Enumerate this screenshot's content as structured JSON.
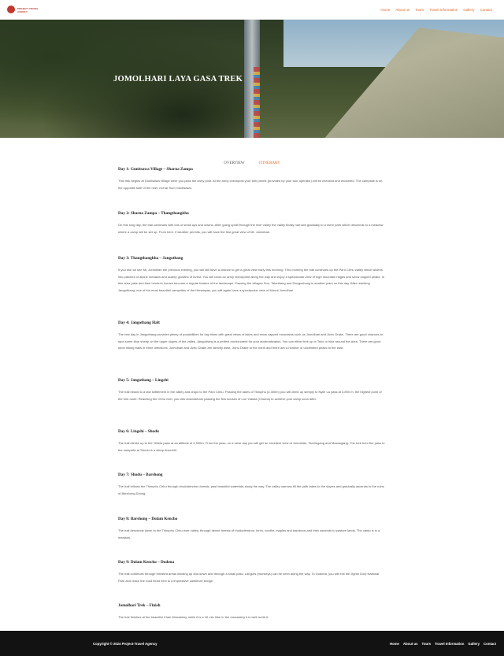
{
  "brand": {
    "logo_text": "PROJECT TRAVEL AGENCY"
  },
  "nav": [
    "Home",
    "About us",
    "Tours",
    "Travel Information",
    "Gallery",
    "Contact"
  ],
  "hero": {
    "title": "JOMOLHARI LAYA GASA TREK"
  },
  "tabs": [
    {
      "label": "OVERVIEW",
      "active": false
    },
    {
      "label": "ITINERARY",
      "active": true
    }
  ],
  "itinerary": [
    {
      "title": "Day 1: Gunitsawa Village – Sharna Zampa",
      "text": "This trek begins at Gunitsawa Village were you pass the army post. At the army checkpost your trek permit (provided by your tour operator) will be checked and endorsed. The campsite is on the opposite side of the river, not far from Gunitsawa."
    },
    {
      "title": "Day 2: Sharna Zampa – Thangthangkha",
      "text": "On this long day, the trail continues with lots of small ups and downs. After going uphill through the river valley the valley finally narrows gradually to a mere path which descends to a meadow where a camp will be set up. From here, if weather permits, you will have the first great view of Mt. Jomolhari."
    },
    {
      "title": "Day 3: Thangthangkha – Jangothang",
      "text": "If you did not see Mt. Jomolhari the previous evening, you will still have a chance to get a great view early this morning. This morning the trail continues up the Paro Chhu valley which widens into patches of alpine meadow and scanty growths of forest. You will cross an army checkpoint along the way and enjoy a spectacular view of high mountain ridges and snow capped peaks. In this area yaks and their herder's homes become a regular feature of the landscape. Passing the villages Soe, Takethang and Dangochang is another point on this day. After reaching Jangothang, one of the most beautiful campsites of the Himalayas, you will again have a spectacular view of Mount Jomolhari."
    },
    {
      "title": "Day 4: Jangothang Halt",
      "text": "The rest day in Jangothang provides plenty of possibilities for day hikes with great views of lakes and snow capped mountains such as Jomolhari and Jichu Drake. There are good chances to spot some blue sheep on the upper slopes of the valley. Jangothang is a perfect environment for your acclimatization. You can either trek up to Tsho or hike around the area. There are good short hiking trails in three directions. Jomolhari and Jichu Drake are directly west, Jichu Drake to the north and there are a number of unclimbed peaks to the east."
    },
    {
      "title": "Day 5: Jangothang – Lingshi",
      "text": "The trail heads to a last settlement in the valley and drops to the Paro Chhu. Passing the lakes of Tshophu (4,300m) you will climb up steeply to Nyile La pass at 4,890 m, the highest point of the trek route. Reaching the Chhu river, you trek downstream passing the few houses of Lon Yatoka (Chuma) to achieve your camp soon after."
    },
    {
      "title": "Day 6: Lingshi – Shodu",
      "text": "The trail climbs up to the Yeliela pass at an altitude of 4,930m. From the pass, on a clear day you will get an excellent view of Jomolhari, Tserimgang and Masangang. The trek from the pass to the campsite at Shodu is a steep downhill."
    },
    {
      "title": "Day 7: Shodu – Barshong",
      "text": "The trail follows the Thimphu Chhu through rhododendron forests, past beautiful waterfalls along the way. The valley narrows till the path takes to the slopes and gradually ascends to the ruins of Barshong Dzong."
    },
    {
      "title": "Day 8: Barshong – Dolam Kencho",
      "text": "The trail descends down to the Thimphu Chhu river valley, through dense forests of rhododendron, birch, conifer, maples and bamboos and then ascends to pasture lands. The camp is in a meadow."
    },
    {
      "title": "Day 9: Dolam Kencho – Dodena",
      "text": "The trail continues through forested areas winding up and down and through a small pass. Langurs (monkeys) can be seen along the way. To Dodena, you will exit the Jigme Dorji National Park and reach the road head next to a impressive cantilever bridge."
    },
    {
      "title": "Jomolhari Trek – Finish",
      "text": "The trek finishes at the beautiful Chari Monastery, while it is a 40 min hike to the monastery it is well worth it."
    }
  ],
  "footer": {
    "copyright": "Copyright © 2024 Project-Travel Agency",
    "nav": [
      "Home",
      "About us",
      "Tours",
      "Travel Information",
      "Gallery",
      "Contact"
    ]
  },
  "colors": {
    "accent": "#e0692a",
    "footer_bg": "#121212"
  }
}
